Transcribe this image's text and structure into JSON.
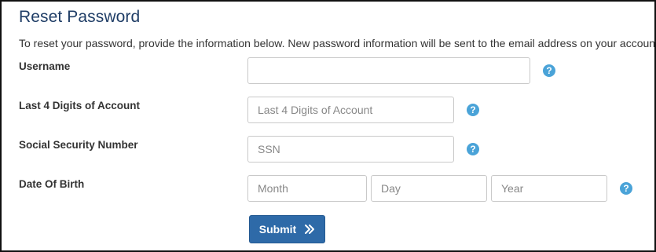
{
  "page": {
    "title": "Reset Password",
    "description": "To reset your password, provide the information below. New password information will be sent to the email address on your account."
  },
  "form": {
    "username": {
      "label": "Username",
      "value": "",
      "placeholder": "",
      "help_icon": "question-circle-icon"
    },
    "account_digits": {
      "label": "Last 4 Digits of Account",
      "value": "",
      "placeholder": "Last 4 Digits of Account",
      "help_icon": "question-circle-icon"
    },
    "ssn": {
      "label": "Social Security Number",
      "value": "",
      "placeholder": "SSN",
      "help_icon": "question-circle-icon"
    },
    "dob": {
      "label": "Date Of Birth",
      "month_placeholder": "Month",
      "day_placeholder": "Day",
      "year_placeholder": "Year",
      "help_icon": "question-circle-icon"
    },
    "help_glyph": "?",
    "submit_label": "Submit",
    "submit_icon": "double-chevron-right-icon"
  },
  "colors": {
    "title": "#1f3d66",
    "help_icon": "#4aa3d8",
    "submit_bg": "#2e6aa8"
  }
}
